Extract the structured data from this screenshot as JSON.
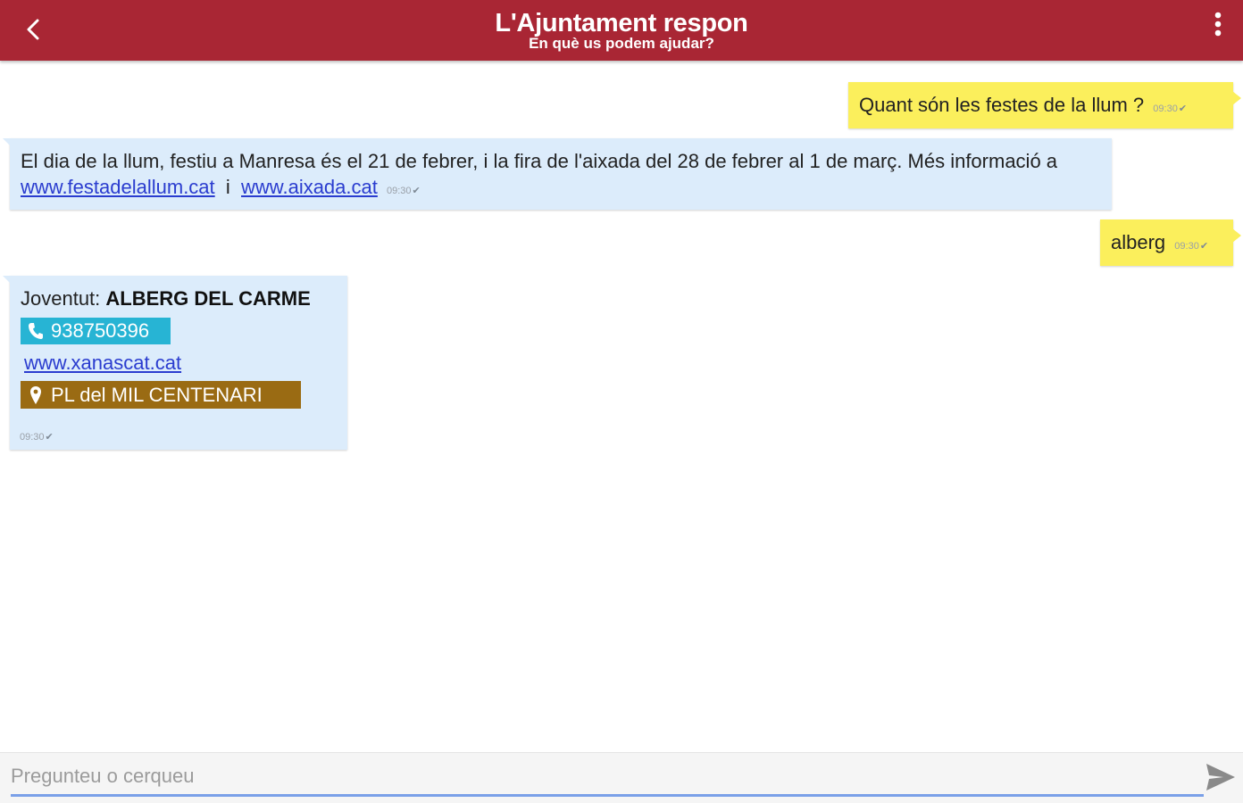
{
  "header": {
    "title": "L'Ajuntament respon",
    "subtitle": "En què us podem ajudar?",
    "back_icon": "chevron-left-icon",
    "menu_icon": "more-vertical-icon",
    "background_color": "#a92634"
  },
  "messages": [
    {
      "direction": "outgoing",
      "text": "Quant són les festes de la llum ?",
      "time": "09:30",
      "status_icon": "double-check-icon"
    },
    {
      "direction": "incoming",
      "text": "El dia de la llum, festiu a Manresa és el 21 de febrer, i la fira de l'aixada del 28 de febrer al 1 de març. Més informació a",
      "link1": "www.festadelallum.cat",
      "joiner": "i",
      "link2": "www.aixada.cat",
      "time": "09:30",
      "status_icon": "double-check-icon"
    },
    {
      "direction": "outgoing",
      "text": "alberg",
      "time": "09:30",
      "status_icon": "double-check-icon"
    },
    {
      "direction": "incoming",
      "category": "Joventut:",
      "name": "ALBERG DEL CARME",
      "phone": "938750396",
      "website": "www.xanascat.cat",
      "address": "PL del MIL CENTENARI",
      "time": "09:30",
      "status_icon": "double-check-icon",
      "phone_color": "#27b4d4",
      "address_color": "#9a6b13"
    }
  ],
  "input": {
    "placeholder": "Pregunteu o cerqueu",
    "value": "",
    "send_icon": "send-icon"
  },
  "colors": {
    "outgoing_bubble": "#fbef5c",
    "incoming_bubble": "#dcecfb",
    "link": "#2a3ccf"
  }
}
